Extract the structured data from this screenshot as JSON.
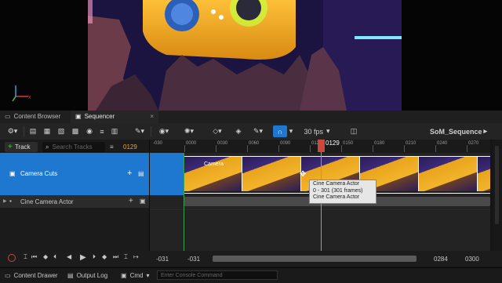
{
  "tabs": [
    {
      "label": "Content Browser",
      "icon": "folder-icon"
    },
    {
      "label": "Sequencer",
      "icon": "film-icon",
      "close": "×"
    }
  ],
  "toolbar": {
    "fps": "30 fps",
    "sequence_name": "SoM_Sequence",
    "current_frame_display": "0129"
  },
  "left_panel": {
    "add_track_label": "Track",
    "search_placeholder": "Search Tracks",
    "current_frame": "0129",
    "camera_cuts_label": "Camera Cuts",
    "actor_label": "Cine Camera Actor"
  },
  "timeline": {
    "ruler_start": "-030",
    "ruler_labels": [
      "0000",
      "0030",
      "0060",
      "0090",
      "0120",
      "0150",
      "0180",
      "0210",
      "0240",
      "0270"
    ],
    "playhead_label": "0129",
    "camera_section_label": "Camera",
    "tooltip_line1": "Cine Camera Actor",
    "tooltip_line2": "0 - 301 (301 frames)",
    "tooltip_line3": "Cine Camera Actor"
  },
  "footer": {
    "view_start": "-031",
    "work_start": "-031",
    "work_end": "0284",
    "view_end": "0300"
  },
  "statusbar": {
    "content_drawer": "Content Drawer",
    "output_log": "Output Log",
    "cmd": "Cmd",
    "console_placeholder": "Enter Console Command"
  },
  "colors": {
    "selection_blue": "#1f78d0",
    "frame_orange": "#e8a41c",
    "playhead_red": "#c94a3a"
  }
}
